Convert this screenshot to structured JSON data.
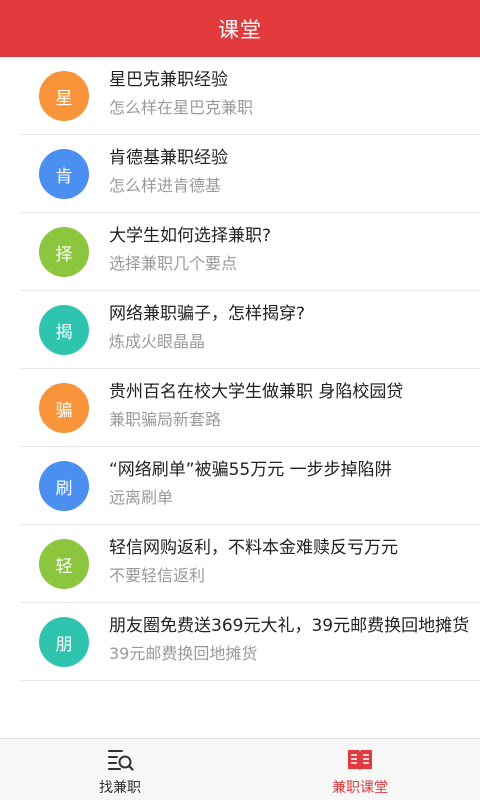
{
  "header": {
    "title": "课堂",
    "color": "#e23a3d"
  },
  "items": [
    {
      "badge": "星",
      "color": "#f8953b",
      "title": "星巴克兼职经验",
      "subtitle": "怎么样在星巴克兼职"
    },
    {
      "badge": "肯",
      "color": "#4b8ff0",
      "title": "肯德基兼职经验",
      "subtitle": "怎么样进肯德基"
    },
    {
      "badge": "择",
      "color": "#8cc63f",
      "title": "大学生如何选择兼职?",
      "subtitle": "选择兼职几个要点"
    },
    {
      "badge": "揭",
      "color": "#2ec4b0",
      "title": "网络兼职骗子，怎样揭穿?",
      "subtitle": "炼成火眼晶晶"
    },
    {
      "badge": "骗",
      "color": "#f8953b",
      "title": "贵州百名在校大学生做兼职 身陷校园贷",
      "subtitle": "兼职骗局新套路"
    },
    {
      "badge": "刷",
      "color": "#4b8ff0",
      "title": "“网络刷单”被骗55万元 一步步掉陷阱",
      "subtitle": "远离刷单"
    },
    {
      "badge": "轻",
      "color": "#8cc63f",
      "title": "轻信网购返利，不料本金难赎反亏万元",
      "subtitle": "不要轻信返利"
    },
    {
      "badge": "朋",
      "color": "#2ec4b0",
      "title": "朋友圈免费送369元大礼，39元邮费换回地摊货",
      "subtitle": "39元邮费换回地摊货"
    }
  ],
  "tabs": [
    {
      "label": "找兼职",
      "icon": "search-list-icon",
      "active": false
    },
    {
      "label": "兼职课堂",
      "icon": "book-icon",
      "active": true
    }
  ]
}
